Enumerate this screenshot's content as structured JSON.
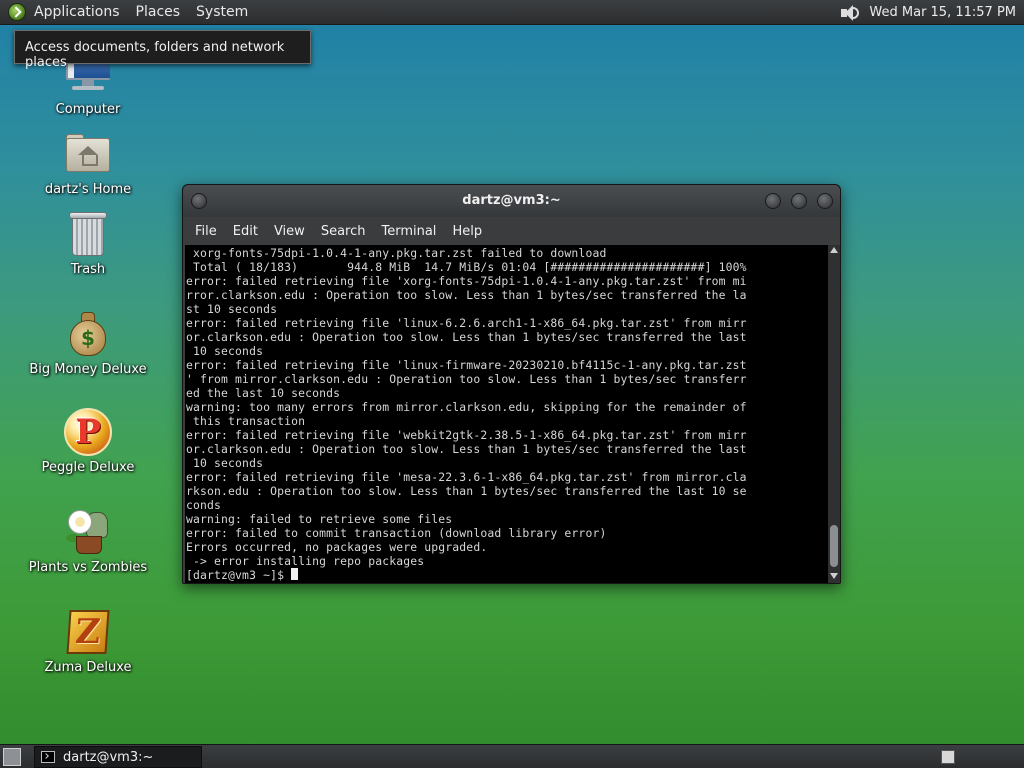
{
  "top_panel": {
    "menus": [
      "Applications",
      "Places",
      "System"
    ],
    "clock": "Wed Mar 15, 11:57 PM"
  },
  "tooltip": "Access documents, folders and network places",
  "desktop_icons": [
    {
      "label": "Computer",
      "icon": "computer-icon"
    },
    {
      "label": "dartz's Home",
      "icon": "home-folder-icon"
    },
    {
      "label": "Trash",
      "icon": "trash-icon"
    },
    {
      "label": "Big Money Deluxe",
      "icon": "money-bag-icon"
    },
    {
      "label": "Peggle Deluxe",
      "icon": "peggle-icon"
    },
    {
      "label": "Plants vs Zombies",
      "icon": "plants-vs-zombies-icon"
    },
    {
      "label": "Zuma Deluxe",
      "icon": "zuma-icon"
    }
  ],
  "terminal": {
    "title": "dartz@vm3:~",
    "menu": [
      "File",
      "Edit",
      "View",
      "Search",
      "Terminal",
      "Help"
    ],
    "lines": [
      " xorg-fonts-75dpi-1.0.4-1-any.pkg.tar.zst failed to download",
      " Total ( 18/183)       944.8 MiB  14.7 MiB/s 01:04 [######################] 100%",
      "error: failed retrieving file 'xorg-fonts-75dpi-1.0.4-1-any.pkg.tar.zst' from mi",
      "rror.clarkson.edu : Operation too slow. Less than 1 bytes/sec transferred the la",
      "st 10 seconds",
      "error: failed retrieving file 'linux-6.2.6.arch1-1-x86_64.pkg.tar.zst' from mirr",
      "or.clarkson.edu : Operation too slow. Less than 1 bytes/sec transferred the last",
      " 10 seconds",
      "error: failed retrieving file 'linux-firmware-20230210.bf4115c-1-any.pkg.tar.zst",
      "' from mirror.clarkson.edu : Operation too slow. Less than 1 bytes/sec transferr",
      "ed the last 10 seconds",
      "warning: too many errors from mirror.clarkson.edu, skipping for the remainder of",
      " this transaction",
      "error: failed retrieving file 'webkit2gtk-2.38.5-1-x86_64.pkg.tar.zst' from mirr",
      "or.clarkson.edu : Operation too slow. Less than 1 bytes/sec transferred the last",
      " 10 seconds",
      "error: failed retrieving file 'mesa-22.3.6-1-x86_64.pkg.tar.zst' from mirror.cla",
      "rkson.edu : Operation too slow. Less than 1 bytes/sec transferred the last 10 se",
      "conds",
      "warning: failed to retrieve some files",
      "error: failed to commit transaction (download library error)",
      "Errors occurred, no packages were upgraded.",
      " -> error installing repo packages"
    ],
    "prompt": "[dartz@vm3 ~]$ "
  },
  "taskbar": {
    "task_label": "dartz@vm3:~"
  }
}
